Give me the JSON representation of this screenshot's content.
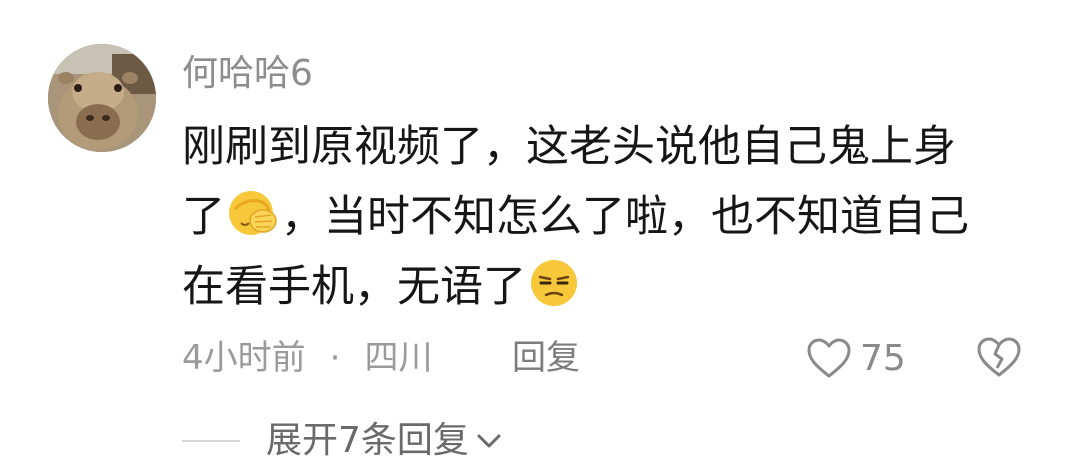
{
  "comment": {
    "username": "何哈哈6",
    "text_line1": "刚刷到原视频了，这老头说他自己鬼上身",
    "text_line2a": "了",
    "text_line2b": "，当时不知怎么了啦，也不知道自己",
    "text_line3a": "在看手机，无语了",
    "emoji_1": "facepalm-emoji",
    "emoji_2": "unamused-face-emoji",
    "time": "4小时前",
    "separator": "·",
    "location": "四川",
    "reply_label": "回复",
    "like_count": "75",
    "expand_label": "展开7条回复"
  },
  "colors": {
    "username": "#8d8d8d",
    "text": "#161616",
    "meta": "#9a9a9a"
  }
}
